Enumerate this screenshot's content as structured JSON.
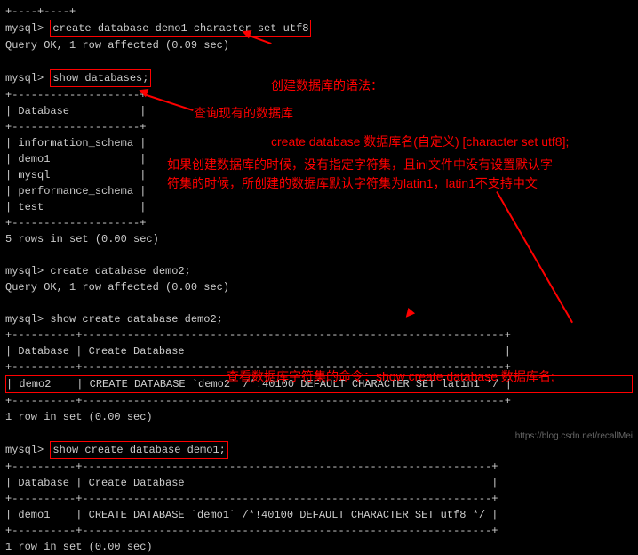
{
  "top_rule": "+----+----+",
  "cmd1": {
    "prompt": "mysql> ",
    "text": "create database demo1 character set utf8"
  },
  "result1": "Query OK, 1 row affected (0.09 sec)",
  "cmd2": {
    "prompt": "mysql> ",
    "text": "show databases;"
  },
  "db_list": {
    "border": "+--------------------+",
    "header": "| Database           |",
    "rows": [
      "| information_schema |",
      "| demo1              |",
      "| mysql              |",
      "| performance_schema |",
      "| test               |"
    ],
    "footer": "5 rows in set (0.00 sec)"
  },
  "cmd3": {
    "prompt": "mysql> ",
    "text": "create database demo2;"
  },
  "result3": "Query OK, 1 row affected (0.00 sec)",
  "cmd4": {
    "prompt": "mysql> ",
    "text": "show create database demo2;"
  },
  "table1": {
    "border": "+----------+------------------------------------------------------------------+",
    "header": "| Database | Create Database                                                  |",
    "row": "| demo2    | CREATE DATABASE `demo2` /*!40100 DEFAULT CHARACTER SET latin1 */ |",
    "footer": "1 row in set (0.00 sec)"
  },
  "cmd5": {
    "prompt": "mysql> ",
    "text": "show create database demo1;"
  },
  "table2": {
    "border": "+----------+----------------------------------------------------------------+",
    "header": "| Database | Create Database                                                |",
    "row": "| demo1    | CREATE DATABASE `demo1` /*!40100 DEFAULT CHARACTER SET utf8 */ |",
    "footer": "1 row in set (0.00 sec)"
  },
  "anno1": {
    "line1": "创建数据库的语法：",
    "line2": "create database 数据库名(自定义) [character set utf8];"
  },
  "anno2": "查询现有的数据库",
  "anno3": "如果创建数据库的时候，没有指定字符集，且ini文件中没有设置默认字\n符集的时候，所创建的数据库默认字符集为latin1，latin1不支持中文",
  "anno4": "查看数据库字符集的命令：show create database 数据库名;",
  "watermark": "https://blog.csdn.net/recallMei"
}
